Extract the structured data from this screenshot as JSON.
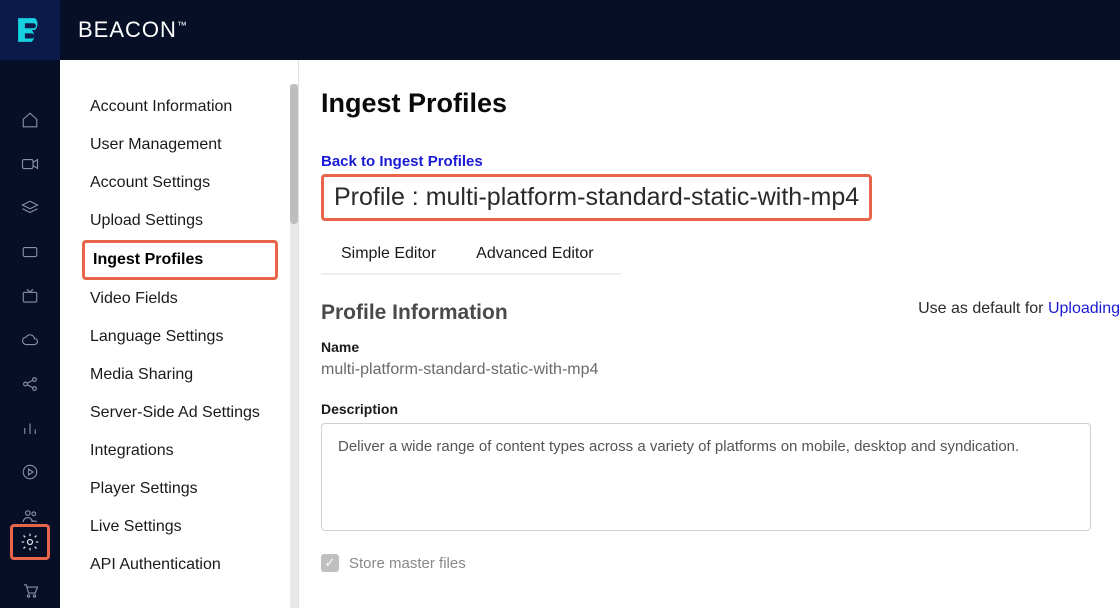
{
  "brand": "BEACON",
  "brand_tm": "™",
  "sidebar": {
    "items": [
      {
        "label": "Account Information"
      },
      {
        "label": "User Management"
      },
      {
        "label": "Account Settings"
      },
      {
        "label": "Upload Settings"
      },
      {
        "label": "Ingest Profiles"
      },
      {
        "label": "Video Fields"
      },
      {
        "label": "Language Settings"
      },
      {
        "label": "Media Sharing"
      },
      {
        "label": "Server-Side Ad Settings"
      },
      {
        "label": "Integrations"
      },
      {
        "label": "Player Settings"
      },
      {
        "label": "Live Settings"
      },
      {
        "label": "API Authentication"
      }
    ],
    "active_index": 4
  },
  "page": {
    "title": "Ingest Profiles",
    "back_link": "Back to Ingest Profiles",
    "profile_heading": "Profile : multi-platform-standard-static-with-mp4",
    "default_prefix": "Use as default for ",
    "default_link": "Uploading",
    "tabs": [
      {
        "label": "Simple Editor"
      },
      {
        "label": "Advanced Editor"
      }
    ],
    "section_title": "Profile Information",
    "name_label": "Name",
    "name_value": "multi-platform-standard-static-with-mp4",
    "desc_label": "Description",
    "desc_value": "Deliver a wide range of content types across a variety of platforms on mobile, desktop and syndication.",
    "store_master_label": "Store master files"
  }
}
